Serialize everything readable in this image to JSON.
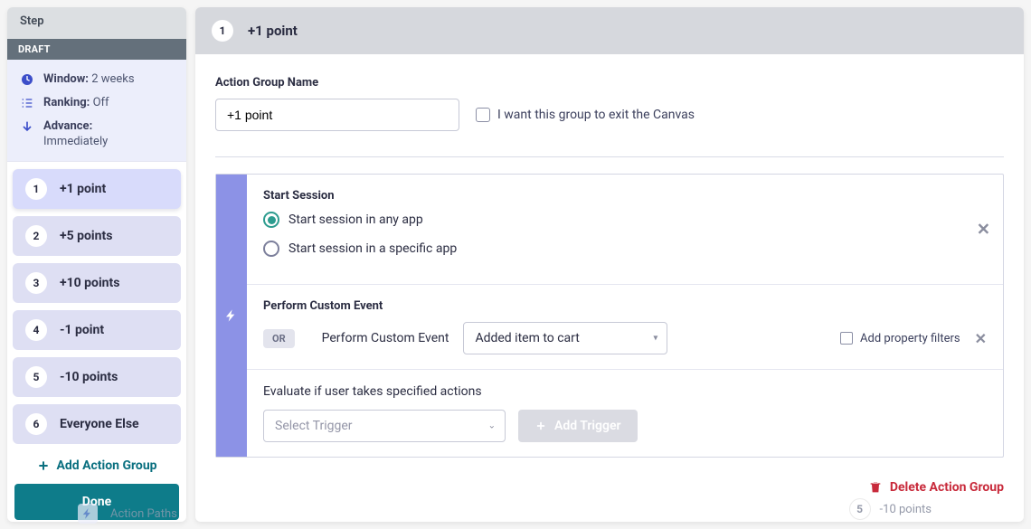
{
  "sidebar": {
    "step_label": "Step",
    "draft_label": "DRAFT",
    "meta": {
      "window_key": "Window:",
      "window_val": "2 weeks",
      "ranking_key": "Ranking:",
      "ranking_val": "Off",
      "advance_key": "Advance:",
      "advance_val": "Immediately"
    },
    "groups": [
      {
        "num": "1",
        "label": "+1 point"
      },
      {
        "num": "2",
        "label": "+5 points"
      },
      {
        "num": "3",
        "label": "+10 points"
      },
      {
        "num": "4",
        "label": "-1 point"
      },
      {
        "num": "5",
        "label": "-10 points"
      },
      {
        "num": "6",
        "label": "Everyone Else"
      }
    ],
    "add_group": "Add Action Group",
    "done": "Done"
  },
  "main": {
    "badge": "1",
    "title": "+1 point",
    "group_name_label": "Action Group Name",
    "group_name_value": "+1 point",
    "exit_canvas_label": "I want this group to exit the Canvas",
    "session": {
      "title": "Start Session",
      "opt_any": "Start session in any app",
      "opt_specific": "Start session in a specific app"
    },
    "custom_event": {
      "title": "Perform Custom Event",
      "or": "OR",
      "label": "Perform Custom Event",
      "selected": "Added item to cart",
      "filters": "Add property filters"
    },
    "evaluate": {
      "text": "Evaluate if user takes specified actions",
      "placeholder": "Select Trigger",
      "add": "Add Trigger"
    },
    "delete": "Delete Action Group"
  },
  "bg": {
    "action_paths": "Action Paths",
    "row_num": "5",
    "row_label": "-10 points"
  }
}
